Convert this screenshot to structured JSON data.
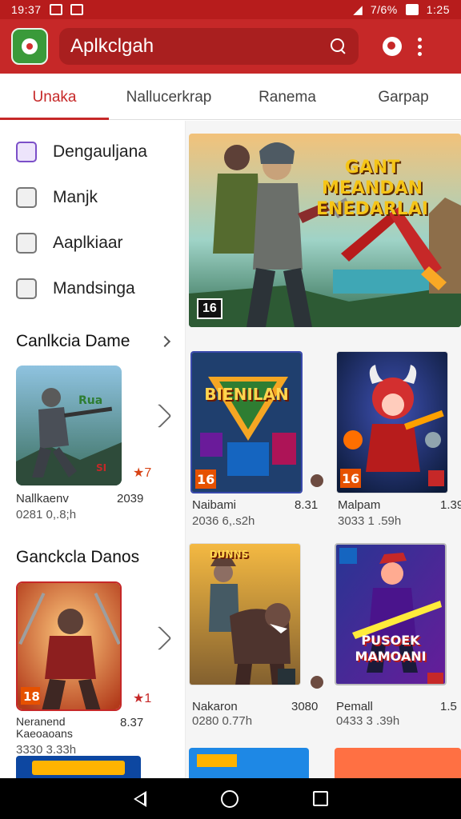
{
  "status": {
    "time": "19:37",
    "right_text": "7/6%",
    "clock": "1:25"
  },
  "appbar": {
    "search_text": "Aplkclgah"
  },
  "tabs": [
    {
      "label": "Unaka",
      "active": true
    },
    {
      "label": "Nallucerkrap",
      "active": false
    },
    {
      "label": "Ranema",
      "active": false
    },
    {
      "label": "Garpap",
      "active": false
    }
  ],
  "sidebar": {
    "items": [
      {
        "label": "Dengauljana",
        "icon": "edit-icon"
      },
      {
        "label": "Manjk",
        "icon": "chart-icon"
      },
      {
        "label": "Aaplkiaar",
        "icon": "speed-icon"
      },
      {
        "label": "Mandsinga",
        "icon": "gauge-icon"
      }
    ],
    "section1": {
      "title": "Canlkcia Dame",
      "card": {
        "title": "Nallkaenv",
        "size": "2039",
        "meta": "0281 0,.8;h",
        "badge_text": "SI",
        "rating": "7"
      }
    },
    "section2": {
      "title": "Ganckcla Danos",
      "card": {
        "title": "Neranend Kaeoaoans",
        "size": "8.37",
        "meta": "3330 3.33h",
        "badge": "18",
        "rating": "1"
      }
    }
  },
  "main": {
    "banner": {
      "title": "GANT MEANDAN ENEDARLAI",
      "badge": "16"
    },
    "games": [
      {
        "title": "Naibami",
        "size": "8.31",
        "meta": "2036 6,.s2h",
        "badge": "16",
        "tile_text": "BIENILAN"
      },
      {
        "title": "Malpam",
        "size": "1.39",
        "meta": "3033 1 .59h",
        "badge": "16"
      },
      {
        "title": "Nakaron",
        "size": "3080",
        "meta": "0280 0.77h",
        "tile_text": "DUNNS"
      },
      {
        "title": "Pemall",
        "size": "1.5",
        "meta": "0433 3 .39h",
        "tile_text": "PUSOEK MAMOANI"
      }
    ]
  },
  "colors": {
    "primary": "#c62828",
    "status": "#b71c1c"
  }
}
